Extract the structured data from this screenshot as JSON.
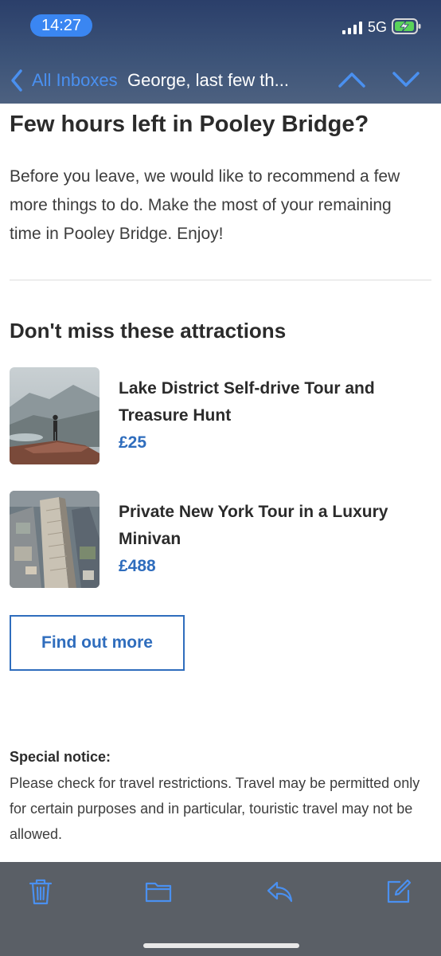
{
  "status_bar": {
    "time": "14:27",
    "network": "5G",
    "signal_icon": "cellular-signal-icon",
    "battery_icon": "battery-charging-icon"
  },
  "nav": {
    "back_label": "All Inboxes",
    "title": "George, last few th...",
    "icons": [
      "back-chevron-icon",
      "chevron-up-icon",
      "chevron-down-icon"
    ]
  },
  "email": {
    "headline": "Few hours left in Pooley Bridge?",
    "intro": "Before you leave, we would like to recommend a few more things to do. Make the most of your remaining time in Pooley Bridge. Enjoy!",
    "section_title": "Don't miss these attractions",
    "attractions": [
      {
        "name": "Lake District Self-drive Tour and Treasure Hunt",
        "price": "£25",
        "image": "mountain-hiker-photo"
      },
      {
        "name": "Private New York Tour in a Luxury Minivan",
        "price": "£488",
        "image": "new-york-aerial-photo"
      }
    ],
    "cta_label": "Find out more",
    "notice_title": "Special notice:",
    "notice_body": "Please check for travel restrictions. Travel may be permitted only for certain purposes and in particular, touristic travel may not be allowed."
  },
  "toolbar": {
    "icons": [
      "trash-icon",
      "folder-icon",
      "reply-icon",
      "compose-icon"
    ]
  },
  "colors": {
    "accent_blue": "#2f6dbd",
    "nav_link_blue": "#4a90f0",
    "time_pill": "#3a86f2",
    "toolbar_bg": "#5a5f66"
  }
}
